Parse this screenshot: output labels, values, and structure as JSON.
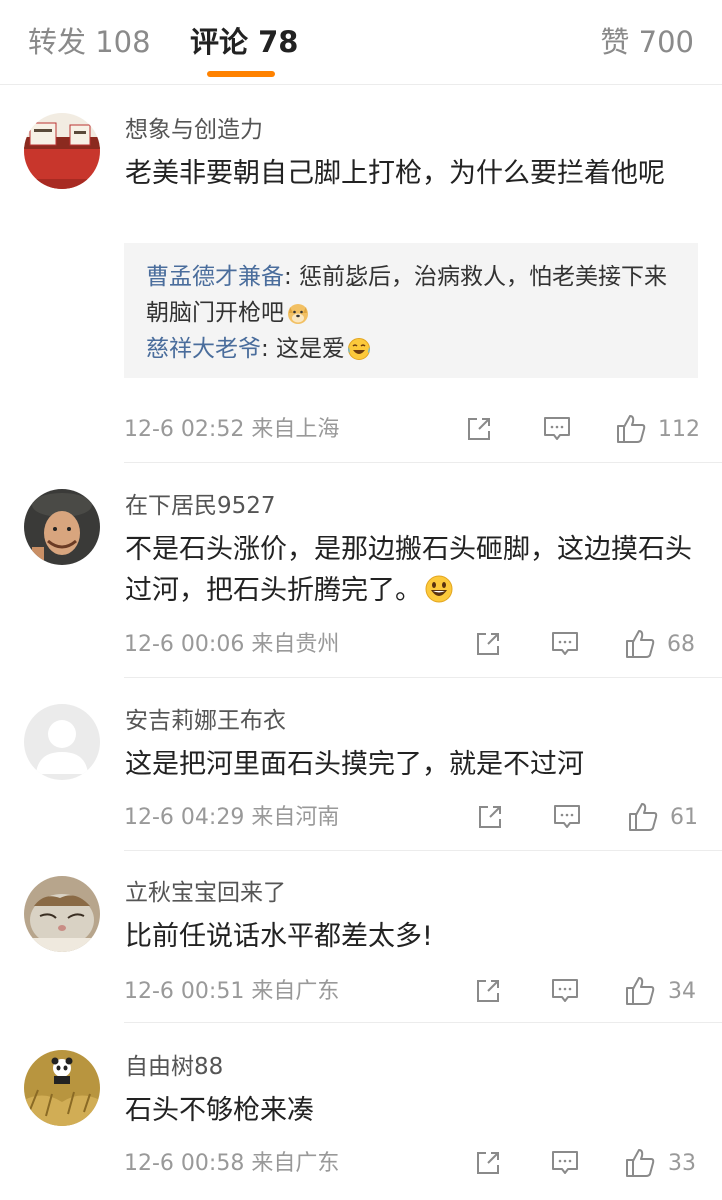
{
  "tabs": {
    "repost": "转发 108",
    "comments": "评论 78",
    "likes": "赞 700",
    "accent_color": "#ff8200"
  },
  "comments": [
    {
      "username": "想象与创造力",
      "content": "老美非要朝自己脚上打枪，为什么要拦着他呢",
      "replies": [
        {
          "name": "曹孟德才兼备",
          "text": ": 惩前毖后，治病救人，怕老美接下来朝脑门开枪吧",
          "emoji": "doge-emoji"
        },
        {
          "name": "慈祥大老爷",
          "text": ": 这是爱",
          "emoji": "laugh-cry-emoji"
        }
      ],
      "meta": "12-6 02:52  来自上海",
      "likes": "112"
    },
    {
      "username": "在下居民9527",
      "content": "不是石头涨价，是那边搬石头砸脚，这边摸石头过河，把石头折腾完了。",
      "emoji": "grin-emoji",
      "meta": "12-6 00:06  来自贵州",
      "likes": "68"
    },
    {
      "username": "安吉莉娜王布衣",
      "content": "这是把河里面石头摸完了，就是不过河",
      "meta": "12-6 04:29  来自河南",
      "likes": "61"
    },
    {
      "username": "立秋宝宝回来了",
      "content": "比前任说话水平都差太多!",
      "meta": "12-6 00:51  来自广东",
      "likes": "34"
    },
    {
      "username": "自由树88",
      "content": "石头不够枪来凑",
      "meta": "12-6 00:58  来自广东",
      "likes": "33"
    }
  ],
  "icons": {
    "share": "share-icon",
    "comment": "comment-icon",
    "like": "like-icon"
  }
}
